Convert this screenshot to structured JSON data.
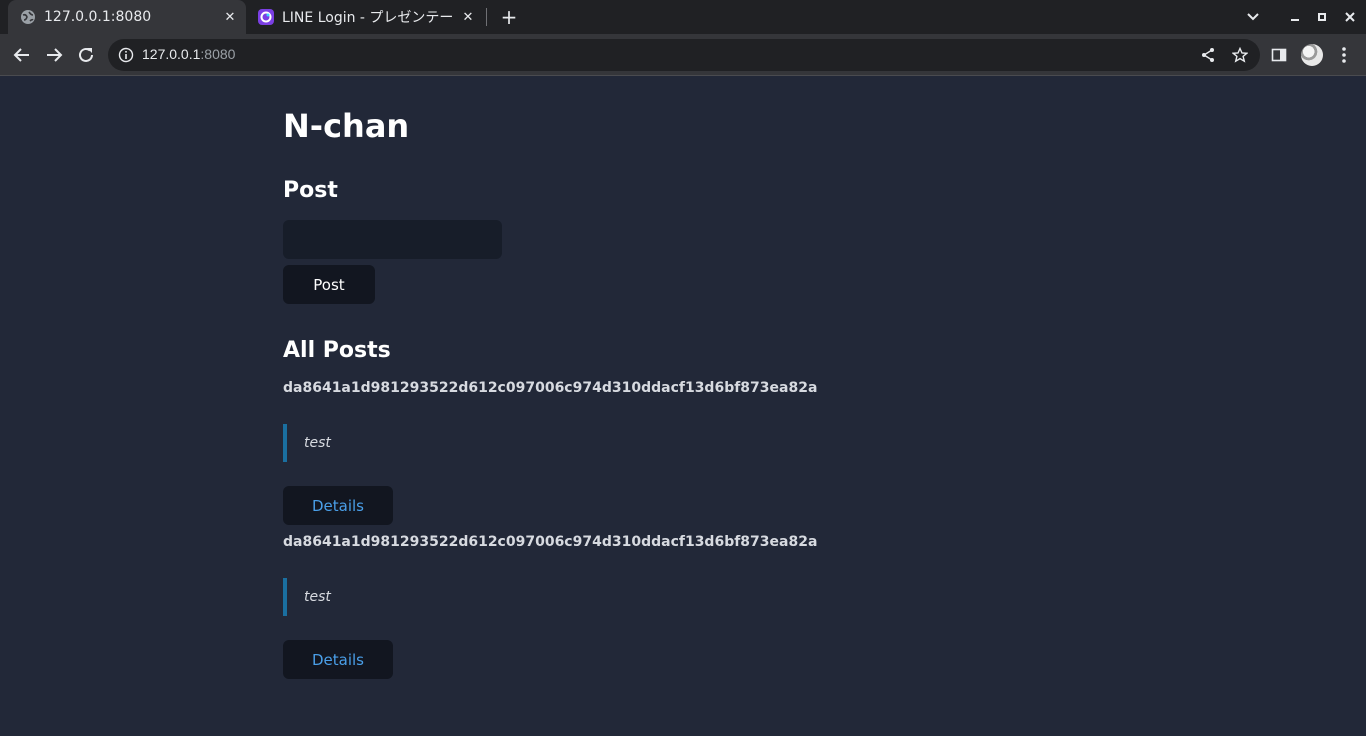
{
  "browser": {
    "tabs": [
      {
        "title": "127.0.0.1:8080",
        "active": true
      },
      {
        "title": "LINE Login - プレゼンテー",
        "active": false
      }
    ],
    "address": {
      "host": "127.0.0.1",
      "port": ":8080"
    }
  },
  "page": {
    "title": "N-chan",
    "post_section": {
      "heading": "Post",
      "input_value": "",
      "button_label": "Post"
    },
    "all_posts": {
      "heading": "All Posts",
      "items": [
        {
          "id": "da8641a1d981293522d612c097006c974d310ddacf13d6bf873ea82a",
          "content": "test",
          "details_label": "Details"
        },
        {
          "id": "da8641a1d981293522d612c097006c974d310ddacf13d6bf873ea82a",
          "content": "test",
          "details_label": "Details"
        }
      ]
    }
  },
  "colors": {
    "page_background": "#222838",
    "link_color": "#4a9fe8",
    "quote_border": "#1a6fa0"
  },
  "icons": [
    "globe-icon",
    "app-favicon-icon",
    "close-icon",
    "new-tab-icon",
    "chevron-down-icon",
    "minimize-icon",
    "maximize-icon",
    "window-close-icon",
    "back-arrow-icon",
    "forward-arrow-icon",
    "reload-icon",
    "info-icon",
    "share-icon",
    "bookmark-star-icon",
    "side-panel-icon",
    "profile-avatar",
    "menu-kebab-icon"
  ]
}
